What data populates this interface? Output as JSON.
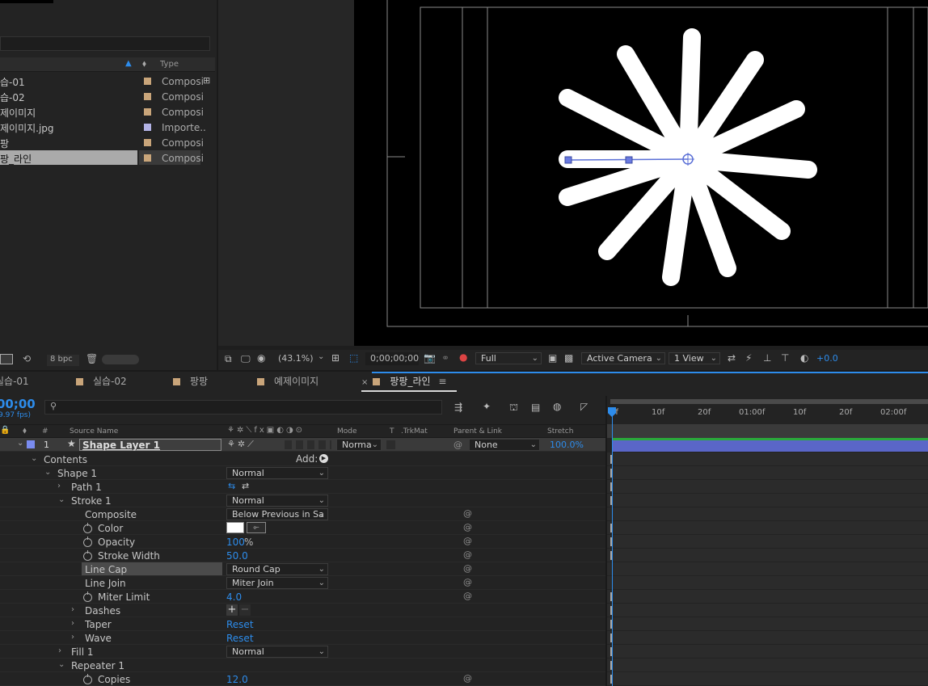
{
  "project": {
    "type_header": "Type",
    "items": [
      {
        "name": "습-01",
        "type": "Composi"
      },
      {
        "name": "습-02",
        "type": "Composi"
      },
      {
        "name": "제이미지",
        "type": "Composi"
      },
      {
        "name": "제이미지.jpg",
        "type": "Importe.."
      },
      {
        "name": "팡",
        "type": "Composi"
      },
      {
        "name": "팡_라인",
        "type": "Composi"
      }
    ],
    "bpc": "8 bpc"
  },
  "viewer": {
    "zoom": "(43.1%)",
    "timecode": "0;00;00;00",
    "resolution": "Full",
    "camera": "Active Camera",
    "views": "1 View",
    "exposure": "+0.0"
  },
  "tabs": [
    "실습-01",
    "실습-02",
    "팡팡",
    "예제이미지",
    "팡팡_라인"
  ],
  "timeline": {
    "current_time": "00;00",
    "fps": "9.97 fps)",
    "columns": {
      "number": "#",
      "source_name": "Source Name",
      "mode": "Mode",
      "t": "T",
      "trkmat": ".TrkMat",
      "parent": "Parent & Link",
      "stretch": "Stretch"
    },
    "ruler": [
      "0f",
      "10f",
      "20f",
      "01:00f",
      "10f",
      "20f",
      "02:00f"
    ],
    "layer": {
      "number": "1",
      "name": "Shape Layer 1",
      "mode": "Norma",
      "parent": "None",
      "stretch": "100.0%"
    },
    "add_label": "Add:",
    "properties": {
      "contents": "Contents",
      "shape1": "Shape 1",
      "shape1_mode": "Normal",
      "path1": "Path 1",
      "stroke1": "Stroke 1",
      "stroke1_mode": "Normal",
      "composite": "Composite",
      "composite_value": "Below Previous in Sa",
      "color": "Color",
      "opacity": "Opacity",
      "opacity_value": "100",
      "opacity_unit": "%",
      "stroke_width": "Stroke Width",
      "stroke_width_value": "50.0",
      "line_cap": "Line Cap",
      "line_cap_value": "Round Cap",
      "line_join": "Line Join",
      "line_join_value": "Miter Join",
      "miter_limit": "Miter Limit",
      "miter_limit_value": "4.0",
      "dashes": "Dashes",
      "taper": "Taper",
      "taper_value": "Reset",
      "wave": "Wave",
      "wave_value": "Reset",
      "fill1": "Fill 1",
      "fill1_mode": "Normal",
      "repeater1": "Repeater 1",
      "copies": "Copies",
      "copies_value": "12.0"
    }
  },
  "colors": {
    "accent": "#2d8ceb",
    "comp_label": "#c9a57a",
    "layer_label": "#7a8cf0",
    "layer_bar": "#5a66c8"
  }
}
